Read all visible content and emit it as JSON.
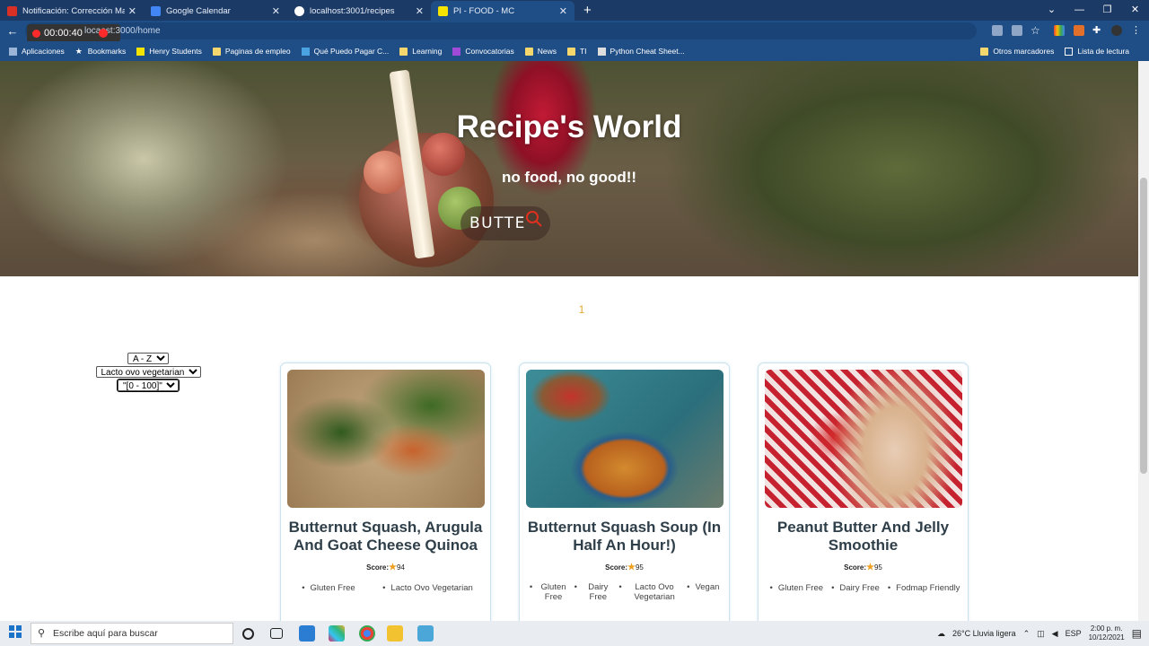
{
  "browser": {
    "tabs": [
      {
        "title": "Notificación: Corrección Mateo C",
        "color": "#d93025",
        "active": false
      },
      {
        "title": "Google Calendar",
        "color": "#4285f4",
        "active": false
      },
      {
        "title": "localhost:3001/recipes",
        "color": "#ffffff",
        "active": false
      },
      {
        "title": "PI - FOOD - MC",
        "color": "#f5e400",
        "active": true
      }
    ],
    "new_tab_symbol": "+",
    "recorder_time": "00:00:40",
    "url_prefix": "loca",
    "url_rest": "ost:3000/home",
    "bookmarks": [
      "Aplicaciones",
      "Bookmarks",
      "Henry Students",
      "Paginas de empleo",
      "Qué Puedo Pagar C...",
      "Learning",
      "Convocatorias",
      "News",
      "TI",
      "Python Cheat Sheet..."
    ],
    "bookmarks_right": [
      "Otros marcadores",
      "Lista de lectura"
    ]
  },
  "hero": {
    "title": "Recipe's World",
    "subtitle": "no food, no good!!",
    "search_value": "BUTTE"
  },
  "pagination": {
    "pages": [
      "1"
    ]
  },
  "filters": {
    "order": "A - Z",
    "diet": "Lacto ovo vegetarian",
    "score_range": "\"[0 - 100]\""
  },
  "recipes": [
    {
      "title": "Butternut Squash, Arugula And Goat Cheese Quinoa",
      "score_label": "Score:",
      "score": "94",
      "diets": [
        "Gluten Free",
        "Lacto Ovo Vegetarian"
      ]
    },
    {
      "title": "Butternut Squash Soup (In Half An Hour!)",
      "score_label": "Score:",
      "score": "95",
      "diets": [
        "Gluten Free",
        "Dairy Free",
        "Lacto Ovo Vegetarian",
        "Vegan"
      ]
    },
    {
      "title": "Peanut Butter And Jelly Smoothie",
      "score_label": "Score:",
      "score": "95",
      "diets": [
        "Gluten Free",
        "Dairy Free",
        "Fodmap Friendly"
      ]
    }
  ],
  "taskbar": {
    "search_placeholder": "Escribe aquí para buscar",
    "weather": "26°C  Lluvia ligera",
    "language": "ESP",
    "time": "2:00 p. m.",
    "date": "10/12/2021"
  },
  "colors": {
    "accent": "#e0a830",
    "browser_frame": "#1f4e86",
    "card_title": "#2f3f4a"
  }
}
